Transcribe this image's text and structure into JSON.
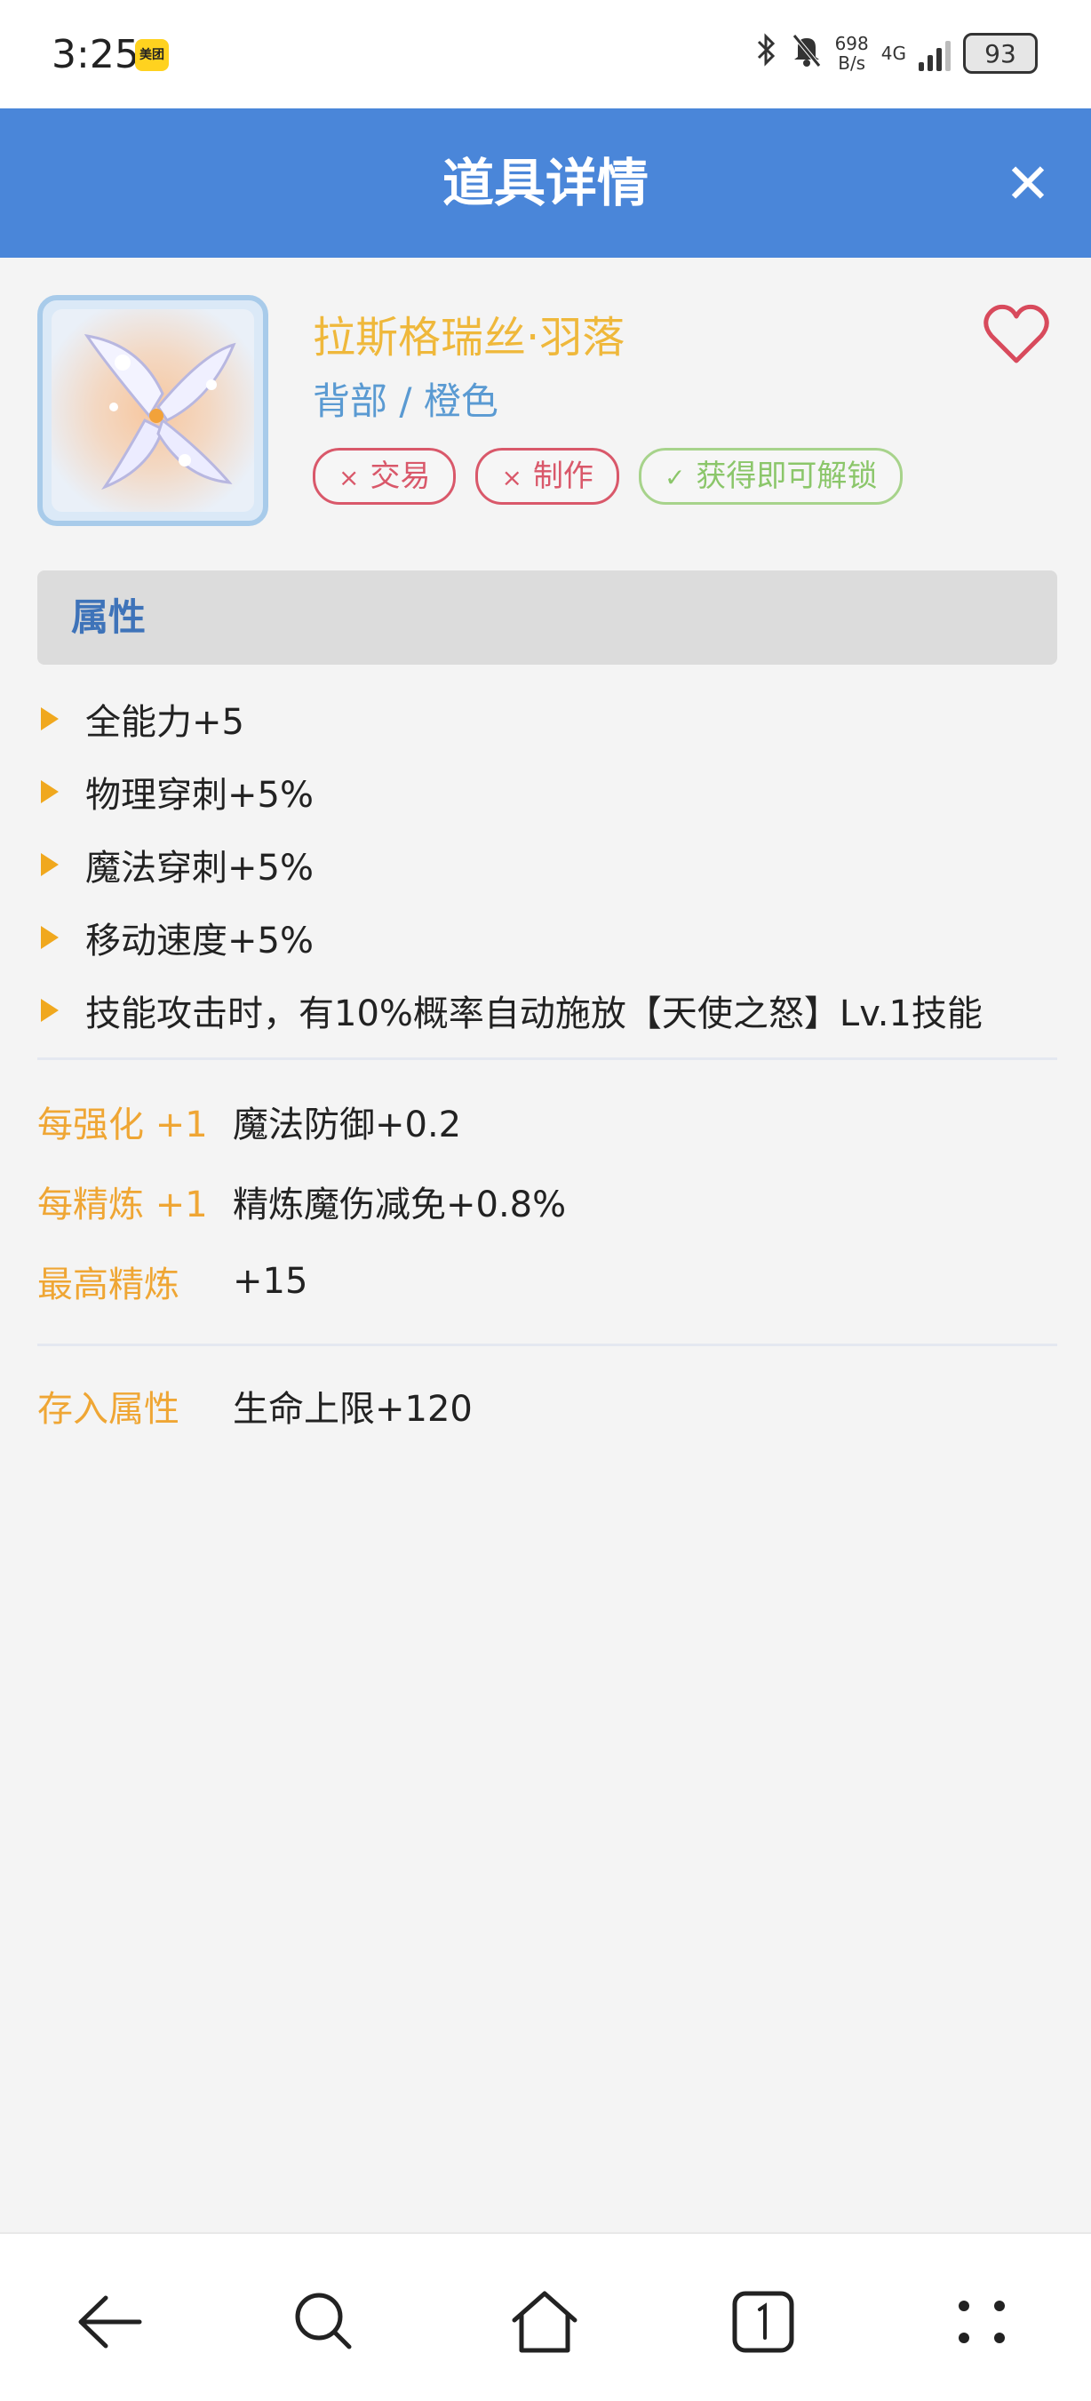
{
  "status_bar": {
    "time": "3:25",
    "app_badge": "美团",
    "net_speed_value": "698",
    "net_speed_unit": "B/s",
    "network_type": "4G",
    "battery": "93",
    "icons": [
      "bluetooth-icon",
      "mute-bell-icon",
      "signal-icon",
      "battery-icon"
    ]
  },
  "header": {
    "title": "道具详情",
    "close_label": "✕"
  },
  "item": {
    "name": "拉斯格瑞丝·羽落",
    "type": "背部 / 橙色",
    "tags": [
      {
        "mark": "×",
        "label": "交易"
      },
      {
        "mark": "×",
        "label": "制作"
      },
      {
        "mark": "✓",
        "label": "获得即可解锁"
      }
    ]
  },
  "attributes_section": {
    "title": "属性",
    "items": [
      "全能力+5",
      "物理穿刺+5%",
      "魔法穿刺+5%",
      "移动速度+5%",
      "技能攻击时，有10%概率自动施放【天使之怒】Lv.1技能"
    ]
  },
  "enhance": {
    "per_strengthen_label": "每强化 +1",
    "per_strengthen_value": "魔法防御+0.2",
    "per_refine_label": "每精炼 +1",
    "per_refine_value": "精炼魔伤减免+0.8%",
    "max_refine_label": "最高精炼",
    "max_refine_value": "+15"
  },
  "deposit": {
    "label": "存入属性",
    "value": "生命上限+120"
  },
  "colors": {
    "header": "#4a86d9",
    "name": "#efb83b",
    "type": "#5a9ad2",
    "tag_no": "#d9586a",
    "tag_yes": "#8bc66a",
    "label": "#efa634"
  }
}
